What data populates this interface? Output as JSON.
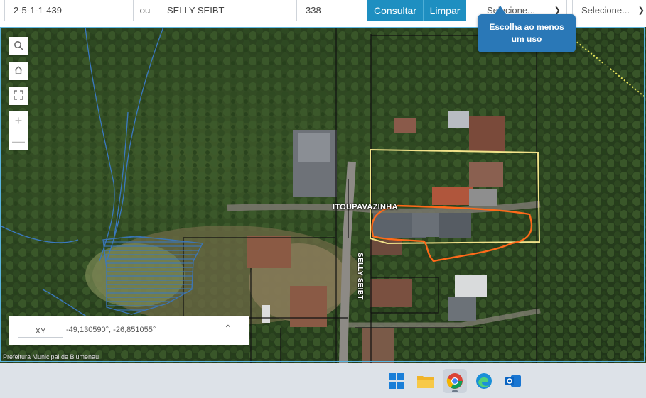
{
  "search": {
    "inscricao_value": "2-5-1-1-439",
    "ou_label": "ou",
    "logradouro_value": "SELLY SEIBT",
    "numero_value": "338",
    "consultar_label": "Consultar",
    "limpar_label": "Limpar",
    "uso_select": "Selecione...",
    "second_select": "Selecione..."
  },
  "tooltip": {
    "text_line1": "Escolha ao menos",
    "text_line2": "um uso"
  },
  "map": {
    "street_label_h": "ITOUPAVAZINHA",
    "street_label_v": "SELLY SEIBT",
    "coords_mode": "XY",
    "coords_value": "-49,130590°, -26,851055°",
    "attribution": "Prefeitura Municipal de Blumenau"
  },
  "tools": [
    "search-icon",
    "home-icon",
    "fullscreen-icon",
    "zoom-in-icon",
    "zoom-out-icon"
  ],
  "taskbar": [
    "windows-start-icon",
    "file-explorer-icon",
    "chrome-icon",
    "edge-icon",
    "outlook-icon"
  ],
  "colors": {
    "primary_button": "#1e8fc1",
    "tooltip": "#2a78b7",
    "parcel_outline": "#f2e28a",
    "drawn_outline": "#ff6a1a",
    "hydro": "#3a78c0"
  }
}
